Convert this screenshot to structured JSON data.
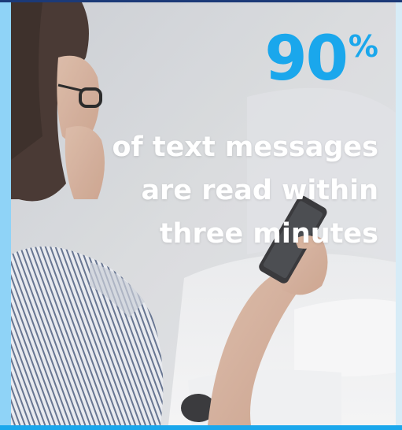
{
  "stat": {
    "number": "90",
    "percent_sign": "%"
  },
  "caption": {
    "lines": [
      "of text messages",
      "are read within",
      "three minutes"
    ]
  },
  "colors": {
    "accent_blue": "#1aa7ec",
    "left_bar": "#8fd3f7",
    "top_bar": "#1c3a78",
    "caption_text": "#ffffff"
  },
  "image": {
    "subject": "woman-reading-phone-photo"
  }
}
